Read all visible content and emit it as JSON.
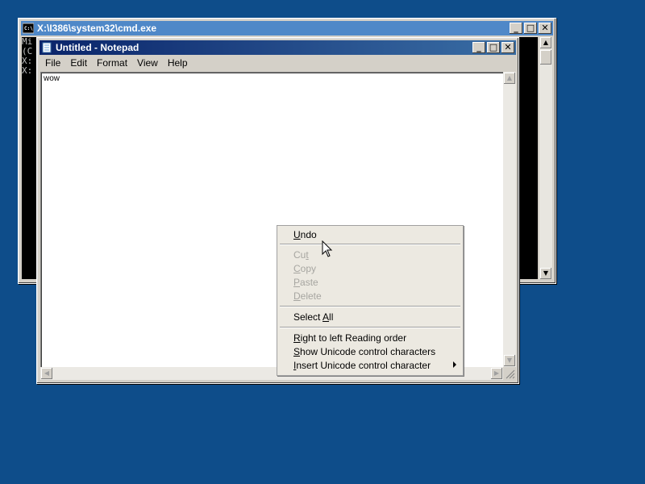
{
  "colors": {
    "desktop": "#0e4d8a",
    "title_active": "#0a246a",
    "title_inactive": "#4f88c8",
    "menu_bg": "#ece9e1",
    "disabled_text": "#a7a6a1"
  },
  "cmd": {
    "title": "X:\\I386\\system32\\cmd.exe",
    "lines": [
      "Mi",
      "(C",
      "",
      "X:",
      "",
      "X:"
    ],
    "icon": "console-icon"
  },
  "notepad": {
    "title": "Untitled - Notepad",
    "icon": "notepad-icon",
    "menu": [
      "File",
      "Edit",
      "Format",
      "View",
      "Help"
    ],
    "text": "wow"
  },
  "context_menu": {
    "items": [
      {
        "pre": "",
        "u": "U",
        "post": "ndo",
        "enabled": true
      },
      {
        "pre": "Cu",
        "u": "t",
        "post": "",
        "enabled": false
      },
      {
        "pre": "",
        "u": "C",
        "post": "opy",
        "enabled": false
      },
      {
        "pre": "",
        "u": "P",
        "post": "aste",
        "enabled": false
      },
      {
        "pre": "",
        "u": "D",
        "post": "elete",
        "enabled": false
      },
      {
        "pre": "Select ",
        "u": "A",
        "post": "ll",
        "enabled": true
      },
      {
        "pre": "",
        "u": "R",
        "post": "ight to left Reading order",
        "enabled": true
      },
      {
        "pre": "",
        "u": "S",
        "post": "how Unicode control characters",
        "enabled": true
      },
      {
        "pre": "",
        "u": "I",
        "post": "nsert Unicode control character",
        "enabled": true,
        "submenu": true
      }
    ]
  }
}
